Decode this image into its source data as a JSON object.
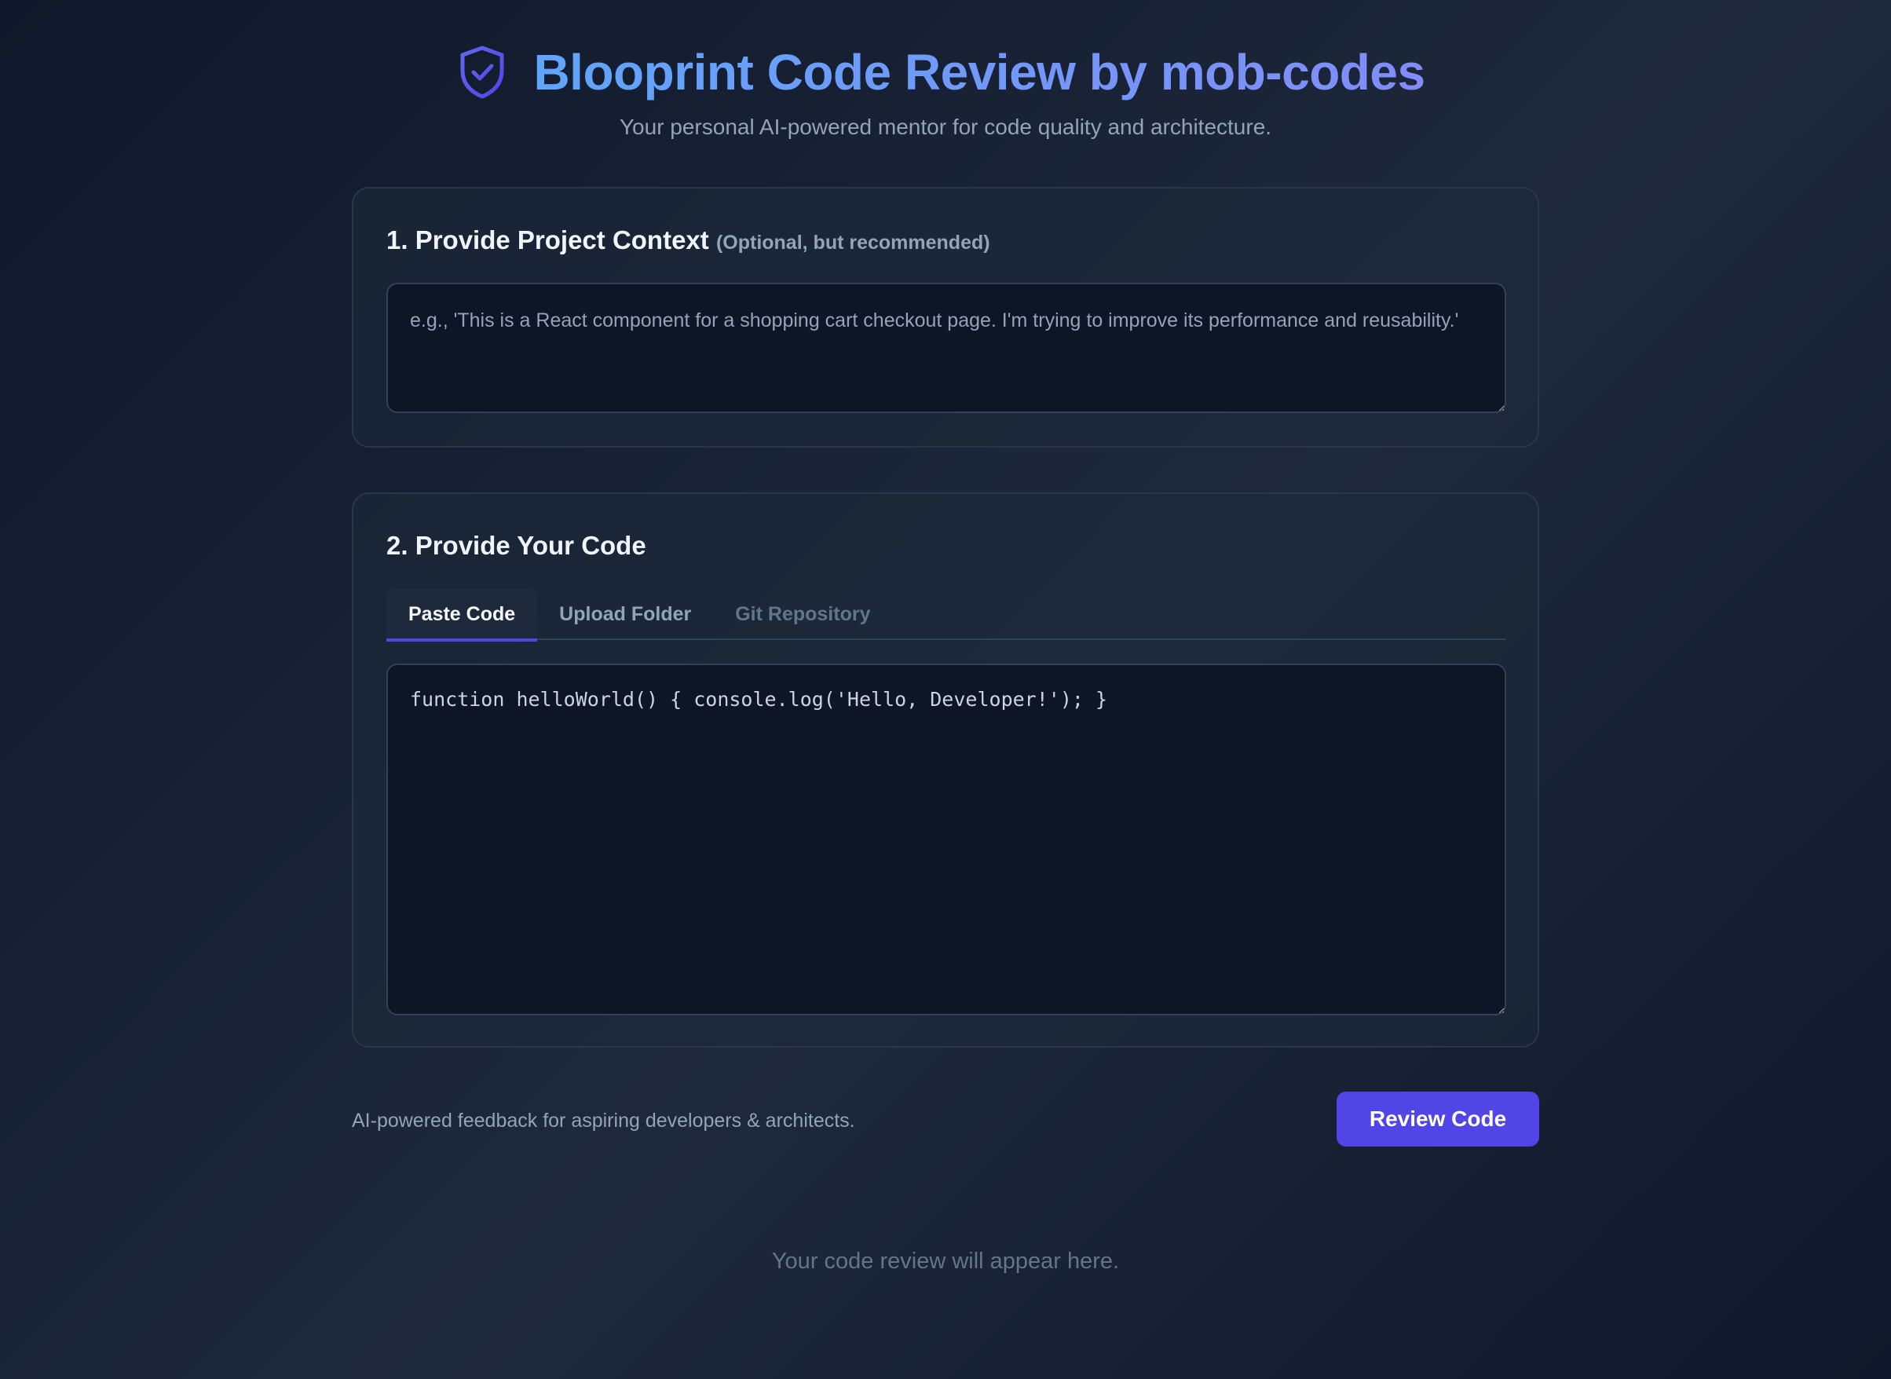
{
  "header": {
    "title": "Blooprint Code Review by mob-codes",
    "subtitle": "Your personal AI-powered mentor for code quality and architecture.",
    "logo_icon": "shield-check-icon"
  },
  "context_section": {
    "heading": "1. Provide Project Context",
    "heading_note": "(Optional, but recommended)",
    "placeholder": "e.g., 'This is a React component for a shopping cart checkout page. I'm trying to improve its performance and reusability.'",
    "value": ""
  },
  "code_section": {
    "heading": "2. Provide Your Code",
    "tabs": [
      {
        "label": "Paste Code",
        "state": "active"
      },
      {
        "label": "Upload Folder",
        "state": "normal"
      },
      {
        "label": "Git Repository",
        "state": "disabled"
      }
    ],
    "code_value": "function helloWorld() { console.log('Hello, Developer!'); }"
  },
  "footer": {
    "note": "AI-powered feedback for aspiring developers & architects.",
    "review_button_label": "Review Code"
  },
  "result": {
    "placeholder_text": "Your code review will appear here."
  },
  "colors": {
    "accent": "#4f46e5",
    "title_gradient_start": "#60a5fa",
    "title_gradient_end": "#818cf8",
    "background": "#0f172a"
  }
}
